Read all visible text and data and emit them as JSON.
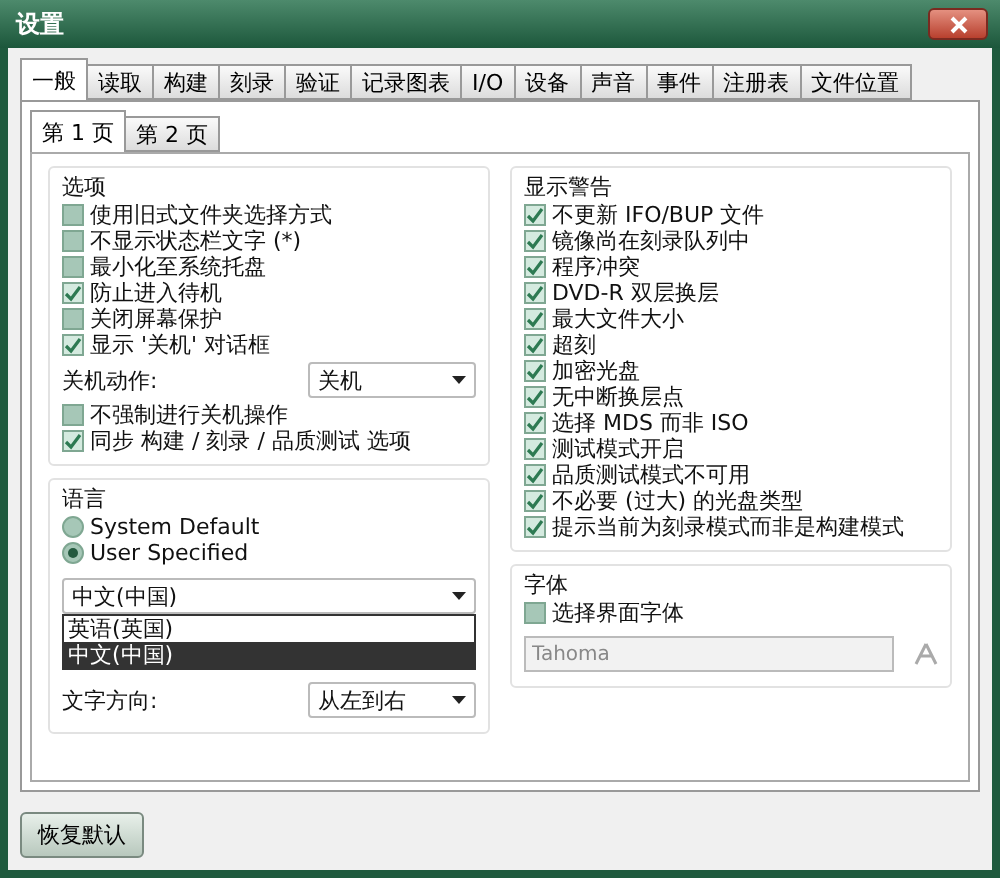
{
  "window": {
    "title": "设置"
  },
  "tabs": [
    {
      "label": "一般",
      "selected": true
    },
    {
      "label": "读取",
      "selected": false
    },
    {
      "label": "构建",
      "selected": false
    },
    {
      "label": "刻录",
      "selected": false
    },
    {
      "label": "验证",
      "selected": false
    },
    {
      "label": "记录图表",
      "selected": false
    },
    {
      "label": "I/O",
      "selected": false
    },
    {
      "label": "设备",
      "selected": false
    },
    {
      "label": "声音",
      "selected": false
    },
    {
      "label": "事件",
      "selected": false
    },
    {
      "label": "注册表",
      "selected": false
    },
    {
      "label": "文件位置",
      "selected": false
    }
  ],
  "subtabs": [
    {
      "label": "第 1 页",
      "selected": true
    },
    {
      "label": "第 2 页",
      "selected": false
    }
  ],
  "options": {
    "title": "选项",
    "items": [
      {
        "label": "使用旧式文件夹选择方式",
        "checked": false
      },
      {
        "label": "不显示状态栏文字 (*)",
        "checked": false
      },
      {
        "label": "最小化至系统托盘",
        "checked": false
      },
      {
        "label": "防止进入待机",
        "checked": true
      },
      {
        "label": "关闭屏幕保护",
        "checked": false
      },
      {
        "label": "显示 '关机' 对话框",
        "checked": true
      }
    ],
    "shutdown": {
      "label": "关机动作:",
      "value": "关机"
    },
    "items2": [
      {
        "label": "不强制进行关机操作",
        "checked": false
      },
      {
        "label": "同步 构建 / 刻录 / 品质测试 选项",
        "checked": true
      }
    ]
  },
  "language": {
    "title": "语言",
    "radios": [
      {
        "label": "System Default",
        "selected": false
      },
      {
        "label": "User Specified",
        "selected": true
      }
    ],
    "value": "中文(中国)",
    "dropdown": [
      {
        "label": "英语(英国)",
        "selected": false
      },
      {
        "label": "中文(中国)",
        "selected": true
      }
    ],
    "direction": {
      "label": "文字方向:",
      "value": "从左到右"
    }
  },
  "warnings": {
    "title": "显示警告",
    "items": [
      {
        "label": "不更新 IFO/BUP 文件",
        "checked": true
      },
      {
        "label": "镜像尚在刻录队列中",
        "checked": true
      },
      {
        "label": "程序冲突",
        "checked": true
      },
      {
        "label": "DVD-R 双层换层",
        "checked": true
      },
      {
        "label": "最大文件大小",
        "checked": true
      },
      {
        "label": "超刻",
        "checked": true
      },
      {
        "label": "加密光盘",
        "checked": true
      },
      {
        "label": "无中断换层点",
        "checked": true
      },
      {
        "label": "选择 MDS 而非 ISO",
        "checked": true
      },
      {
        "label": "测试模式开启",
        "checked": true
      },
      {
        "label": "品质测试模式不可用",
        "checked": true
      },
      {
        "label": "不必要 (过大) 的光盘类型",
        "checked": true
      },
      {
        "label": "提示当前为刻录模式而非是构建模式",
        "checked": true
      }
    ]
  },
  "font": {
    "title": "字体",
    "checkbox": {
      "label": "选择界面字体",
      "checked": false
    },
    "value": "Tahoma",
    "disabled": true
  },
  "footer": {
    "button": "恢复默认"
  }
}
